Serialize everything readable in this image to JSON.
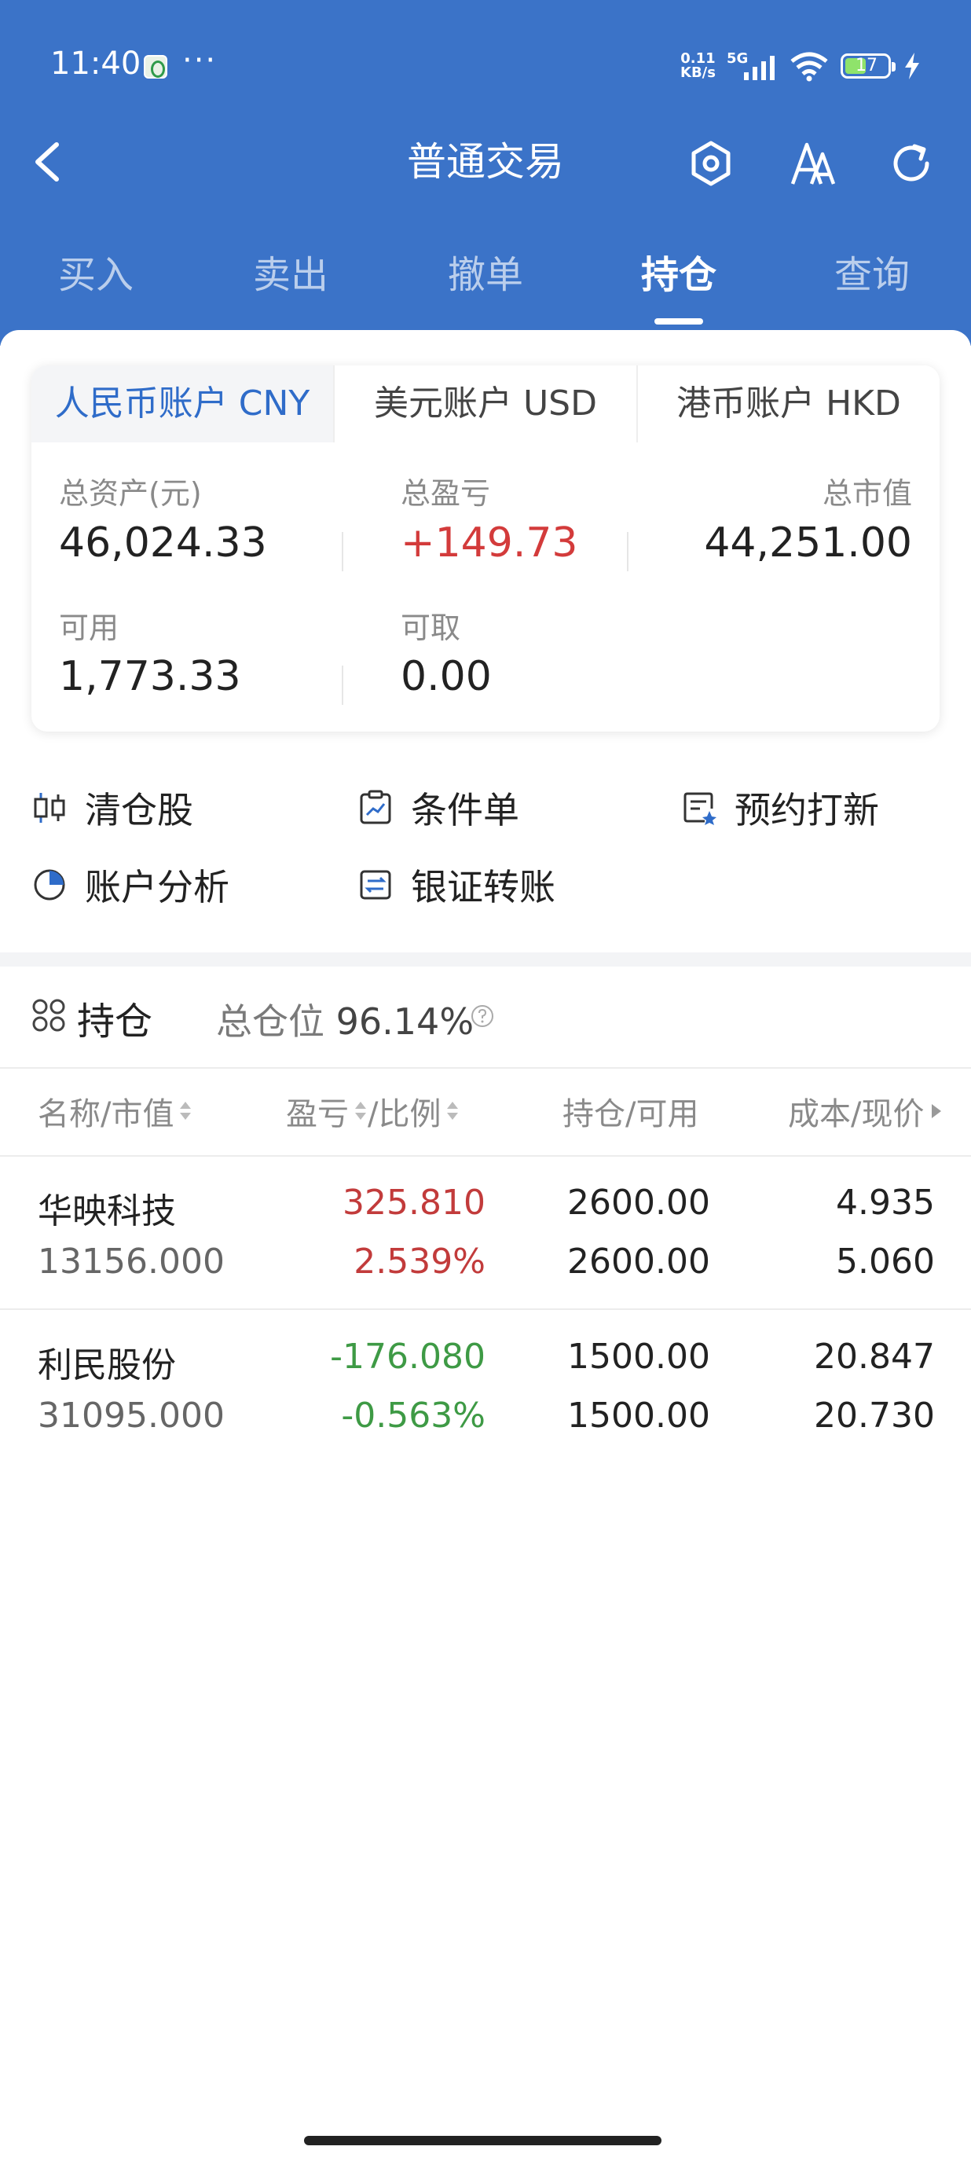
{
  "status_bar": {
    "time": "11:40",
    "dots": "···",
    "speed_top": "0.11",
    "speed_bottom": "KB/s",
    "network": "5G",
    "battery": "17"
  },
  "nav": {
    "title": "普通交易"
  },
  "top_tabs": [
    {
      "label": "买入"
    },
    {
      "label": "卖出"
    },
    {
      "label": "撤单"
    },
    {
      "label": "持仓",
      "active": true
    },
    {
      "label": "查询"
    }
  ],
  "account": {
    "tabs": [
      {
        "label": "人民币账户 CNY",
        "active": true
      },
      {
        "label": "美元账户 USD"
      },
      {
        "label": "港币账户 HKD"
      }
    ],
    "total_assets_label": "总资产(元)",
    "total_assets": "46,024.33",
    "total_pnl_label": "总盈亏",
    "total_pnl": "+149.73",
    "market_value_label": "总市值",
    "market_value": "44,251.00",
    "available_label": "可用",
    "available": "1,773.33",
    "withdrawable_label": "可取",
    "withdrawable": "0.00"
  },
  "quick_actions": [
    {
      "label": "清仓股",
      "icon": "clear-stock-icon"
    },
    {
      "label": "条件单",
      "icon": "condition-order-icon"
    },
    {
      "label": "预约打新",
      "icon": "ipo-reserve-icon"
    },
    {
      "label": "账户分析",
      "icon": "pie-chart-icon"
    },
    {
      "label": "银证转账",
      "icon": "transfer-icon"
    }
  ],
  "holdings": {
    "title": "持仓",
    "ratio_label": "总仓位",
    "ratio": "96.14%",
    "columns": [
      "名称/市值",
      "盈亏",
      "/比例",
      "持仓/可用",
      "成本/现价"
    ],
    "rows": [
      {
        "name": "华映科技",
        "market_value": "13156.000",
        "pnl": "325.810",
        "pnl_ratio": "2.539%",
        "position": "2600.00",
        "available": "2600.00",
        "cost": "4.935",
        "price": "5.060",
        "direction": "up"
      },
      {
        "name": "利民股份",
        "market_value": "31095.000",
        "pnl": "-176.080",
        "pnl_ratio": "-0.563%",
        "position": "1500.00",
        "available": "1500.00",
        "cost": "20.847",
        "price": "20.730",
        "direction": "down"
      }
    ]
  },
  "colors": {
    "header_blue": "#3b73c8",
    "accent_blue": "#2f6cc9",
    "up_red": "#c23b3b",
    "down_green": "#3e9a45"
  }
}
